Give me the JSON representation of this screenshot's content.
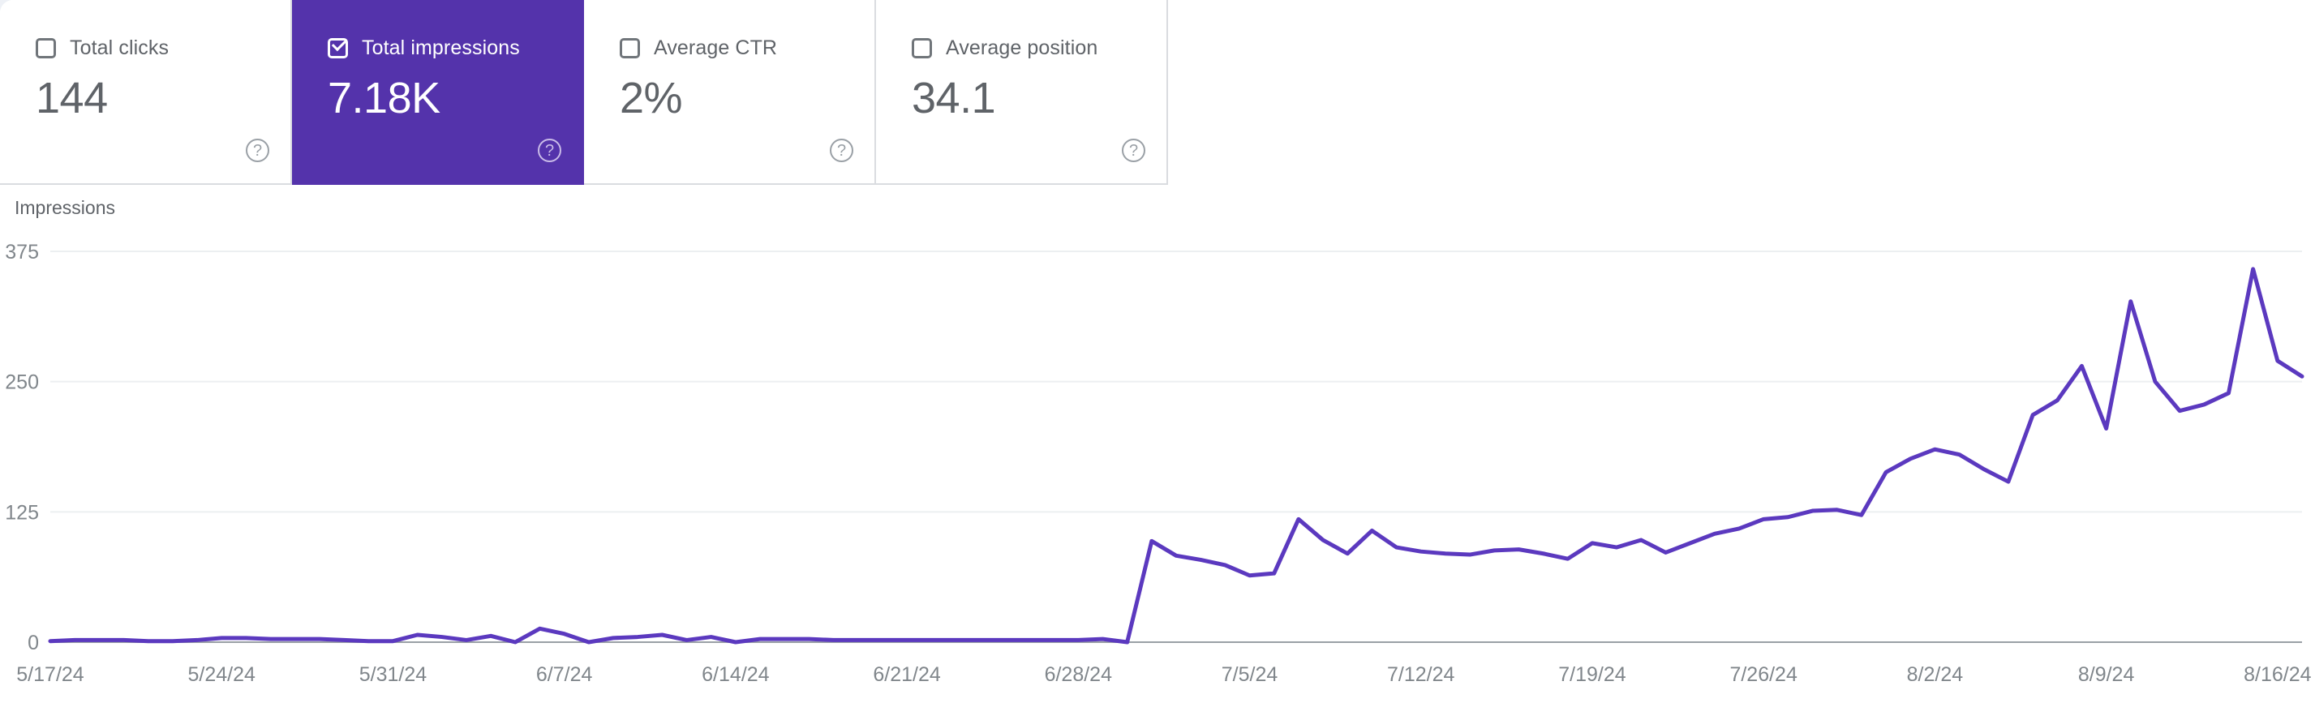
{
  "theme": {
    "accent_purple": "#5433ab",
    "line_color": "#5b39bf",
    "page_background": "#eef1f6",
    "panel_background": "#ffffff",
    "text_gray": "#5f6368",
    "tick_gray": "#80868b",
    "gridline": "#eceff1",
    "axis_line": "#9aa0a6"
  },
  "metric_cards": [
    {
      "label": "Total clicks",
      "value": "144",
      "selected": false,
      "checkbox_icon": "checkbox-unchecked-icon",
      "help_icon": "help-circle-icon",
      "help_label": "?"
    },
    {
      "label": "Total impressions",
      "value": "7.18K",
      "selected": true,
      "checkbox_icon": "checkbox-checked-icon",
      "help_icon": "help-circle-icon",
      "help_label": "?"
    },
    {
      "label": "Average CTR",
      "value": "2%",
      "selected": false,
      "checkbox_icon": "checkbox-unchecked-icon",
      "help_icon": "help-circle-icon",
      "help_label": "?"
    },
    {
      "label": "Average position",
      "value": "34.1",
      "selected": false,
      "checkbox_icon": "checkbox-unchecked-icon",
      "help_icon": "help-circle-icon",
      "help_label": "?"
    }
  ],
  "chart_data": {
    "type": "line",
    "title": "Impressions",
    "xlabel": "",
    "ylabel": "Impressions",
    "ylim": [
      0,
      375
    ],
    "yticks": [
      0,
      125,
      250,
      375
    ],
    "ytick_labels": [
      "0",
      "125",
      "250",
      "375"
    ],
    "grid": true,
    "legend_position": "none",
    "series_name": "Total impressions",
    "series_color": "#5b39bf",
    "x_tick_labels": [
      "5/17/24",
      "5/24/24",
      "5/31/24",
      "6/7/24",
      "6/14/24",
      "6/21/24",
      "6/28/24",
      "7/5/24",
      "7/12/24",
      "7/19/24",
      "7/26/24",
      "8/2/24",
      "8/9/24",
      "8/16/24"
    ],
    "x_tick_indices": [
      0,
      7,
      14,
      21,
      28,
      35,
      42,
      49,
      56,
      63,
      70,
      77,
      84,
      91
    ],
    "x_start": "5/17/24",
    "x_end": "8/16/24",
    "x": [
      "5/17/24",
      "5/18/24",
      "5/19/24",
      "5/20/24",
      "5/21/24",
      "5/22/24",
      "5/23/24",
      "5/24/24",
      "5/25/24",
      "5/26/24",
      "5/27/24",
      "5/28/24",
      "5/29/24",
      "5/30/24",
      "5/31/24",
      "6/1/24",
      "6/2/24",
      "6/3/24",
      "6/4/24",
      "6/5/24",
      "6/6/24",
      "6/7/24",
      "6/8/24",
      "6/9/24",
      "6/10/24",
      "6/11/24",
      "6/12/24",
      "6/13/24",
      "6/14/24",
      "6/15/24",
      "6/16/24",
      "6/17/24",
      "6/18/24",
      "6/19/24",
      "6/20/24",
      "6/21/24",
      "6/22/24",
      "6/23/24",
      "6/24/24",
      "6/25/24",
      "6/26/24",
      "6/27/24",
      "6/28/24",
      "6/29/24",
      "6/30/24",
      "7/1/24",
      "7/2/24",
      "7/3/24",
      "7/4/24",
      "7/5/24",
      "7/6/24",
      "7/7/24",
      "7/8/24",
      "7/9/24",
      "7/10/24",
      "7/11/24",
      "7/12/24",
      "7/13/24",
      "7/14/24",
      "7/15/24",
      "7/16/24",
      "7/17/24",
      "7/18/24",
      "7/19/24",
      "7/20/24",
      "7/21/24",
      "7/22/24",
      "7/23/24",
      "7/24/24",
      "7/25/24",
      "7/26/24",
      "7/27/24",
      "7/28/24",
      "7/29/24",
      "7/30/24",
      "7/31/24",
      "8/1/24",
      "8/2/24",
      "8/3/24",
      "8/4/24",
      "8/5/24",
      "8/6/24",
      "8/7/24",
      "8/8/24",
      "8/9/24",
      "8/10/24",
      "8/11/24",
      "8/12/24",
      "8/13/24",
      "8/14/24",
      "8/15/24",
      "8/16/24"
    ],
    "values": [
      1,
      2,
      2,
      2,
      1,
      1,
      2,
      4,
      4,
      3,
      3,
      3,
      2,
      1,
      1,
      7,
      5,
      2,
      6,
      0,
      13,
      8,
      0,
      4,
      5,
      7,
      2,
      5,
      0,
      3,
      3,
      3,
      2,
      2,
      2,
      2,
      2,
      2,
      2,
      2,
      2,
      2,
      2,
      3,
      0,
      97,
      83,
      79,
      74,
      64,
      66,
      118,
      98,
      85,
      107,
      91,
      87,
      85,
      84,
      88,
      89,
      85,
      80,
      95,
      91,
      98,
      86,
      95,
      104,
      109,
      118,
      120,
      126,
      127,
      122,
      163,
      176,
      185,
      180,
      166,
      154,
      218,
      232,
      265,
      205,
      327,
      250,
      222,
      228,
      239,
      358,
      270,
      255
    ]
  }
}
